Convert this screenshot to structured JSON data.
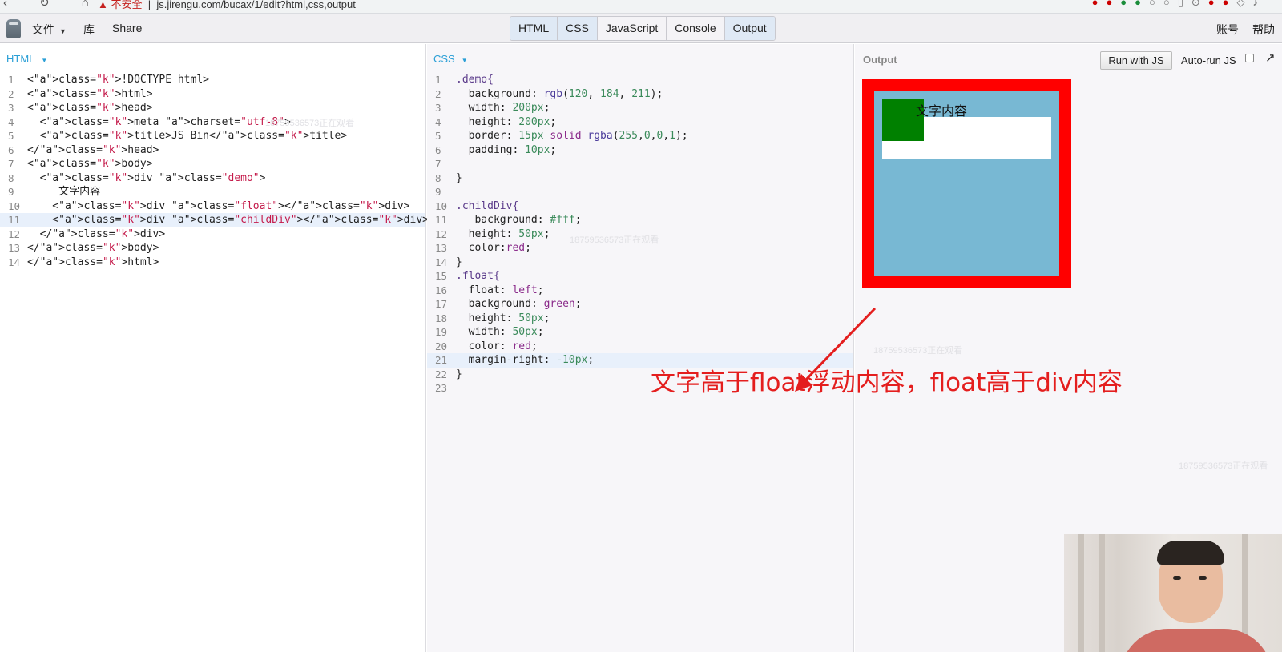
{
  "browser": {
    "url_warning": "▲ 不安全",
    "url": "js.jirengu.com/bucax/1/edit?html,css,output"
  },
  "toolbar": {
    "file_menu": "文件",
    "library": "库",
    "share": "Share",
    "tabs": [
      "HTML",
      "CSS",
      "JavaScript",
      "Console",
      "Output"
    ],
    "account": "账号",
    "help": "帮助"
  },
  "html_panel": {
    "title": "HTML",
    "active_line": 11,
    "lines": [
      "<!DOCTYPE html>",
      "<html>",
      "<head>",
      "  <meta charset=\"utf-8\">",
      "  <title>JS Bin</title>",
      "</head>",
      "<body>",
      "  <div class=\"demo\">",
      "     文字内容",
      "    <div class=\"float\"></div>",
      "    <div class=\"childDiv\"></div>",
      "  </div>",
      "</body>",
      "</html>"
    ]
  },
  "css_panel": {
    "title": "CSS",
    "active_line": 21,
    "lines": [
      ".demo{",
      "  background: rgb(120, 184, 211);",
      "  width: 200px;",
      "  height: 200px;",
      "  border: 15px solid rgba(255,0,0,1);",
      "  padding: 10px;",
      "",
      "}",
      "",
      ".childDiv{",
      "   background: #fff;",
      "  height: 50px;",
      "  color:red;",
      "}",
      ".float{",
      "  float: left;",
      "  background: green;",
      "  height: 50px;",
      "  width: 50px;",
      "  color: red;",
      "  margin-right: -10px;",
      "}",
      ""
    ]
  },
  "output_panel": {
    "title": "Output",
    "run_button": "Run with JS",
    "autorun_label": "Auto-run JS",
    "autorun_checked": false,
    "demo_text": "文字内容"
  },
  "watermark": "18759536573正在观看",
  "annotation": {
    "text": "文字高于float浮动内容，float高于div内容",
    "color": "#e41e1e"
  }
}
